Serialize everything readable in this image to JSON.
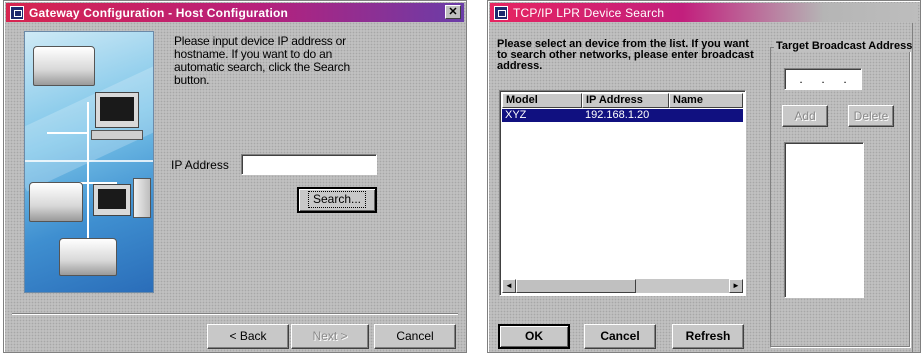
{
  "host_config": {
    "title": "Gateway Configuration - Host Configuration",
    "close_glyph": "✕",
    "instructions": "Please input device IP address or hostname. If you want to do an automatic search, click the Search button.",
    "ip_label": "IP Address",
    "ip_value": "",
    "search_label": "Search...",
    "back_label": "< Back",
    "next_label": "Next >",
    "cancel_label": "Cancel"
  },
  "device_search": {
    "title": "TCP/IP LPR Device Search",
    "instructions": "Please select an device from the list. If you want to search other networks, please enter broadcast address.",
    "columns": [
      "Model",
      "IP Address",
      "Name"
    ],
    "rows": [
      {
        "model": "XYZ",
        "ip": "192.168.1.20",
        "name": ""
      }
    ],
    "group_title": "Target Broadcast Address",
    "broadcast_octets": [
      ".",
      ".",
      "."
    ],
    "add_label": "Add",
    "delete_label": "Delete",
    "ok_label": "OK",
    "cancel_label": "Cancel",
    "refresh_label": "Refresh",
    "scroll_left": "◄",
    "scroll_right": "►"
  }
}
